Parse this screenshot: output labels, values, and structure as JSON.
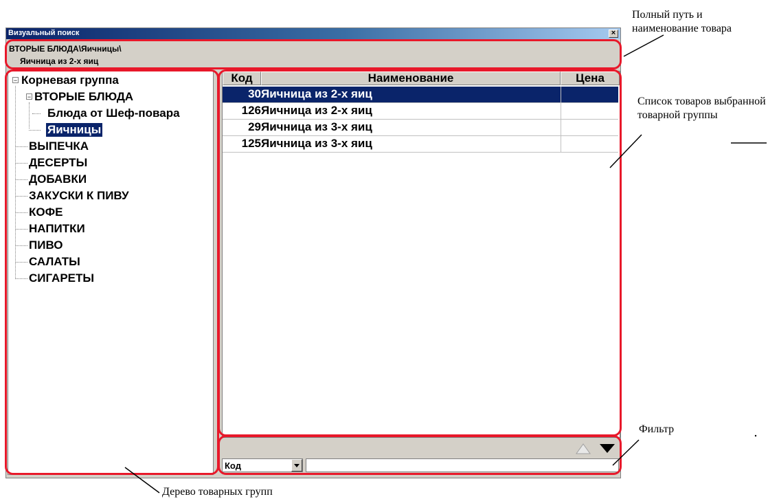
{
  "window": {
    "title": "Визуальный поиск",
    "close_label": "×"
  },
  "path": {
    "line1": "ВТОРЫЕ БЛЮДА\\Яичницы\\",
    "line2": "Яичница из 2-х яиц"
  },
  "tree": {
    "root": "Корневая группа",
    "groups": [
      {
        "label": "ВТОРЫЕ БЛЮДА",
        "expanded": true,
        "children": [
          "Блюда от Шеф-повара",
          "Яичницы"
        ],
        "selected_child": "Яичницы"
      },
      {
        "label": "ВЫПЕЧКА"
      },
      {
        "label": "ДЕСЕРТЫ"
      },
      {
        "label": "ДОБАВКИ"
      },
      {
        "label": "ЗАКУСКИ К ПИВУ"
      },
      {
        "label": "КОФЕ"
      },
      {
        "label": "НАПИТКИ"
      },
      {
        "label": "ПИВО"
      },
      {
        "label": "САЛАТЫ"
      },
      {
        "label": "СИГАРЕТЫ"
      }
    ]
  },
  "grid": {
    "columns": [
      "Код",
      "Наименование",
      "Цена"
    ],
    "rows": [
      {
        "code": "30",
        "name": "Яичница из 2-х яиц",
        "price": "",
        "selected": true
      },
      {
        "code": "126",
        "name": "Яичница из 2-х яиц",
        "price": ""
      },
      {
        "code": "29",
        "name": "Яичница из 3-х яиц",
        "price": ""
      },
      {
        "code": "125",
        "name": "Яичница из 3-х яиц",
        "price": ""
      }
    ]
  },
  "filter": {
    "field_value": "Код",
    "input_value": ""
  },
  "annotations": {
    "path": "Полный путь и наименование товара",
    "list": "Список товаров выбранной товарной группы",
    "filter": "Фильтр",
    "tree": "Дерево товарных групп"
  },
  "colors": {
    "highlight": "#e8182a",
    "selection": "#0a246a",
    "panel": "#d4d0c8"
  }
}
